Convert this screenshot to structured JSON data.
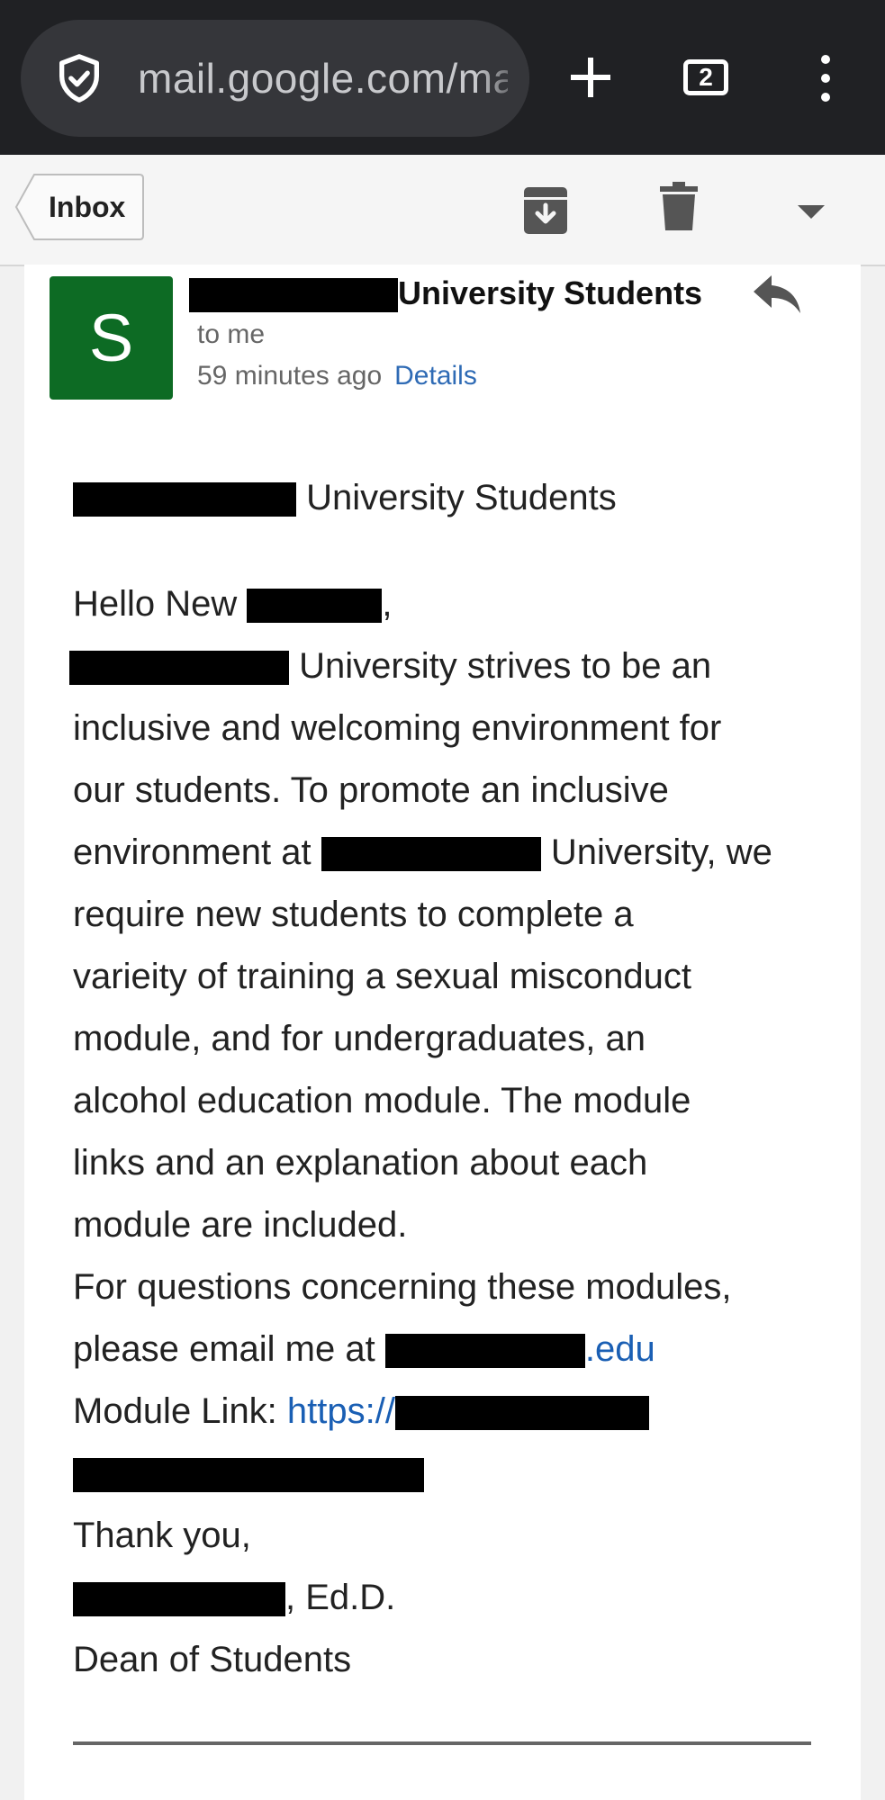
{
  "browser": {
    "url": "mail.google.com/mail",
    "tab_count": "2",
    "icons": [
      "shield-check-icon",
      "plus-icon",
      "tab-switcher-icon",
      "more-vert-icon"
    ]
  },
  "toolbar": {
    "inbox_label": "Inbox",
    "icons": [
      "archive-icon",
      "trash-icon",
      "caret-down-icon"
    ]
  },
  "message": {
    "avatar_letter": "S",
    "sender_suffix": "University Students",
    "to": "to me",
    "time": "59 minutes ago",
    "details": "Details",
    "accent_color": "#0d6b24"
  },
  "body": {
    "subject_suffix": "University Students",
    "greeting_prefix": "Hello New",
    "greeting_suffix": ",",
    "p1_l1": "University strives to be an",
    "p1_l2": "inclusive and welcoming environment for",
    "p1_l3": "our students. To promote an inclusive",
    "p1_l4a": "environment at",
    "p1_l4b": "University, we",
    "p1_l5": "require new students to complete a",
    "p1_l6": "varieity of training a sexual misconduct",
    "p1_l7": "module, and for undergraduates, an",
    "p1_l8": "alcohol education module. The module",
    "p1_l9": "links and an explanation about each",
    "p1_l10": "module are included.",
    "q_l1": "For questions concerning these modules,",
    "q_l2": "please email me at",
    "email_suffix": ".edu",
    "module_label": "Module Link:",
    "module_link_prefix": "https://",
    "thanks": "Thank you,",
    "sig_suffix": ", Ed.D.",
    "title": "Dean of Students"
  }
}
